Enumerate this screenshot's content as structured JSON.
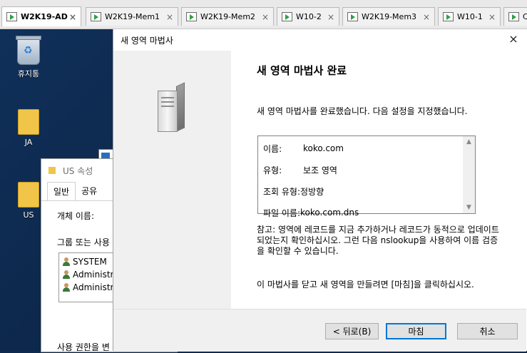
{
  "tabs": [
    {
      "label": "W2K19-AD",
      "active": true
    },
    {
      "label": "W2K19-Mem1",
      "active": false
    },
    {
      "label": "W2K19-Mem2",
      "active": false
    },
    {
      "label": "W10-2",
      "active": false
    },
    {
      "label": "W2K19-Mem3",
      "active": false
    },
    {
      "label": "W10-1",
      "active": false
    },
    {
      "label": "Co",
      "active": false
    }
  ],
  "tab_close_glyph": "×",
  "desktop": {
    "icons": [
      {
        "label": "휴지통",
        "icon": "recycle-bin-icon"
      },
      {
        "label": "JA",
        "icon": "folder-icon"
      },
      {
        "label": "US",
        "icon": "folder-icon"
      }
    ]
  },
  "bg_window": {
    "title": "US 속성",
    "tabs": [
      "일반",
      "공유"
    ],
    "object_label": "개체 이름:",
    "group_label": "그룹 또는 사용",
    "users": [
      "SYSTEM",
      "Administra",
      "Administra"
    ],
    "permission_label": "사용 권한을 변"
  },
  "wizard": {
    "title": "새 영역 마법사",
    "close_glyph": "×",
    "heading": "새 영역 마법사 완료",
    "intro": "새 영역 마법사를 완료했습니다. 다음 설정을 지정했습니다.",
    "summary": [
      {
        "key": "이름:",
        "value": "koko.com"
      },
      {
        "key": "유형:",
        "value": "보조 영역"
      },
      {
        "key": "조회 유형:",
        "value": "정방향"
      },
      {
        "key": "파일 이름:",
        "value": "koko.com.dns"
      }
    ],
    "note": "참고: 영역에 레코드를 지금 추가하거나 레코드가 동적으로 업데이트되었는지 확인하십시오. 그런 다음 nslookup을 사용하여 이름 검증을 확인할 수 있습니다.",
    "final": "이 마법사를 닫고 새 영역을 만들려면 [마침]을 클릭하십시오.",
    "buttons": {
      "back": "< 뒤로(B)",
      "finish": "마침",
      "cancel": "취소"
    }
  }
}
